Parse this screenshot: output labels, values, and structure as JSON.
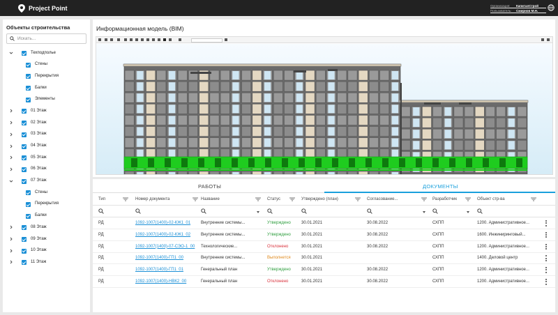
{
  "header": {
    "app_name": "Project Point",
    "org_label": "Организация:",
    "org_value": "КапиталСтрой",
    "user_label": "Пользователь:",
    "user_value": "Смирнов М.Н."
  },
  "sidebar": {
    "title": "Объекты строительства",
    "search_placeholder": "Искать...",
    "items": [
      {
        "label": "Техподполье",
        "level": 0,
        "expanded": true
      },
      {
        "label": "Стены",
        "level": 1
      },
      {
        "label": "Перекрытия",
        "level": 1
      },
      {
        "label": "Балки",
        "level": 1
      },
      {
        "label": "Элементы",
        "level": 1
      },
      {
        "label": "01 Этаж",
        "level": 0,
        "expanded": false
      },
      {
        "label": "02 Этаж",
        "level": 0,
        "expanded": false
      },
      {
        "label": "03 Этаж",
        "level": 0,
        "expanded": false
      },
      {
        "label": "04 Этаж",
        "level": 0,
        "expanded": false
      },
      {
        "label": "05 Этаж",
        "level": 0,
        "expanded": false
      },
      {
        "label": "06 Этаж",
        "level": 0,
        "expanded": false
      },
      {
        "label": "07 Этаж",
        "level": 0,
        "expanded": true
      },
      {
        "label": "Стены",
        "level": 1
      },
      {
        "label": "Перекрытия",
        "level": 1
      },
      {
        "label": "Балки",
        "level": 1
      },
      {
        "label": "08 Этаж",
        "level": 0,
        "expanded": false
      },
      {
        "label": "09 Этаж",
        "level": 0,
        "expanded": false
      },
      {
        "label": "10 Этаж",
        "level": 0,
        "expanded": false
      },
      {
        "label": "11 Этаж",
        "level": 0,
        "expanded": false
      }
    ]
  },
  "bim": {
    "title": "Информационная модель (BIM)",
    "colors": {
      "sky": "#d6ecf7",
      "frame": "#555555",
      "glass": "#cfe6f3",
      "accent_wall": "#e4d8c2",
      "highlight_floor": "#1fcc1f"
    }
  },
  "tabs": {
    "works": "РАБОТЫ",
    "documents": "ДОКУМЕНТЫ",
    "active": "documents"
  },
  "table": {
    "columns": [
      "Тип",
      "Номер документа",
      "Название",
      "Статус",
      "Утверждено (план)",
      "Согласование...",
      "Разработчик",
      "Объект стр-ва"
    ],
    "rows": [
      {
        "type": "РД",
        "number": "1092-1007(1400)-02-КЖ1_01",
        "name": "Внутренние системы...",
        "status": "Утверждено",
        "status_color": "#2e9e3e",
        "approved": "30.01.2021",
        "agreed": "30.08.2022",
        "developer": "СХПП",
        "object": "1200. Административное..."
      },
      {
        "type": "РД",
        "number": "1092-1007(1400)-02-КЖ1_02",
        "name": "Внутренние системы...",
        "status": "Утверждено",
        "status_color": "#2e9e3e",
        "approved": "30.01.2021",
        "agreed": "30.08.2022",
        "developer": "СХПП",
        "object": "1600. Инжиниринговый..."
      },
      {
        "type": "РД",
        "number": "1092-1007(1400)-07-СЭО-1_00",
        "name": "Технологические...",
        "status": "Отклонено",
        "status_color": "#d9303a",
        "approved": "30.01.2021",
        "agreed": "30.08.2022",
        "developer": "СХПП",
        "object": "1200. Административное..."
      },
      {
        "type": "РД",
        "number": "1092-1007(1400)-ГП1_00",
        "name": "Внутренние системы...",
        "status": "Выполнется",
        "status_color": "#e08a1e",
        "approved": "30.01.2021",
        "agreed": "",
        "developer": "СХПП",
        "object": "1400. Деловой центр"
      },
      {
        "type": "РД",
        "number": "1092-1007(1400)-ГП1_01",
        "name": "Генеральный план",
        "status": "Утверждено",
        "status_color": "#2e9e3e",
        "approved": "30.01.2021",
        "agreed": "30.08.2022",
        "developer": "СХПП",
        "object": "1200. Административное..."
      },
      {
        "type": "РД",
        "number": "1092-1007(1400)-НВК2_00",
        "name": "Генеральный план",
        "status": "Отклонено",
        "status_color": "#d9303a",
        "approved": "30.01.2021",
        "agreed": "30.08.2022",
        "developer": "СХПП",
        "object": "1200. Административное..."
      }
    ]
  }
}
